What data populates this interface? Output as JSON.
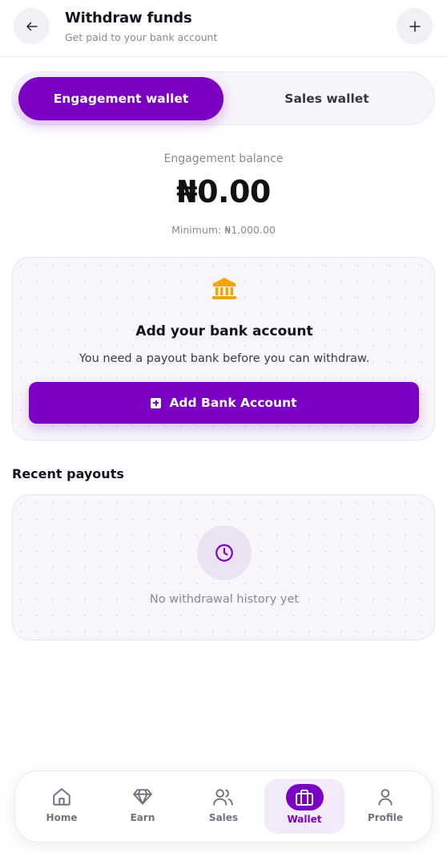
{
  "header": {
    "title": "Withdraw funds",
    "subtitle": "Get paid to your bank account",
    "back_icon": "arrow-left-icon",
    "action_icon": "plus-icon"
  },
  "wallet_tabs": [
    {
      "label": "Engagement wallet",
      "active": true
    },
    {
      "label": "Sales wallet",
      "active": false
    }
  ],
  "balance": {
    "label": "Engagement balance",
    "amount": "₦0.00",
    "minimum": "Minimum: ₦1,000.00"
  },
  "bank_card": {
    "icon": "bank-icon",
    "title": "Add your bank account",
    "description": "You need a payout bank before you can withdraw.",
    "button_label": "Add Bank Account"
  },
  "payouts": {
    "section_title": "Recent payouts",
    "icon": "clock-icon",
    "empty_text": "No withdrawal history yet"
  },
  "nav": {
    "items": [
      {
        "label": "Home",
        "icon": "home-icon",
        "active": false
      },
      {
        "label": "Earn",
        "icon": "diamond-icon",
        "active": false
      },
      {
        "label": "Sales",
        "icon": "users-icon",
        "active": false
      },
      {
        "label": "Wallet",
        "icon": "wallet-icon",
        "active": true
      },
      {
        "label": "Profile",
        "icon": "user-icon",
        "active": false
      }
    ]
  },
  "colors": {
    "brand": "#7c00c4",
    "bank_icon": "#f5a300",
    "muted_text": "#8b8794"
  }
}
